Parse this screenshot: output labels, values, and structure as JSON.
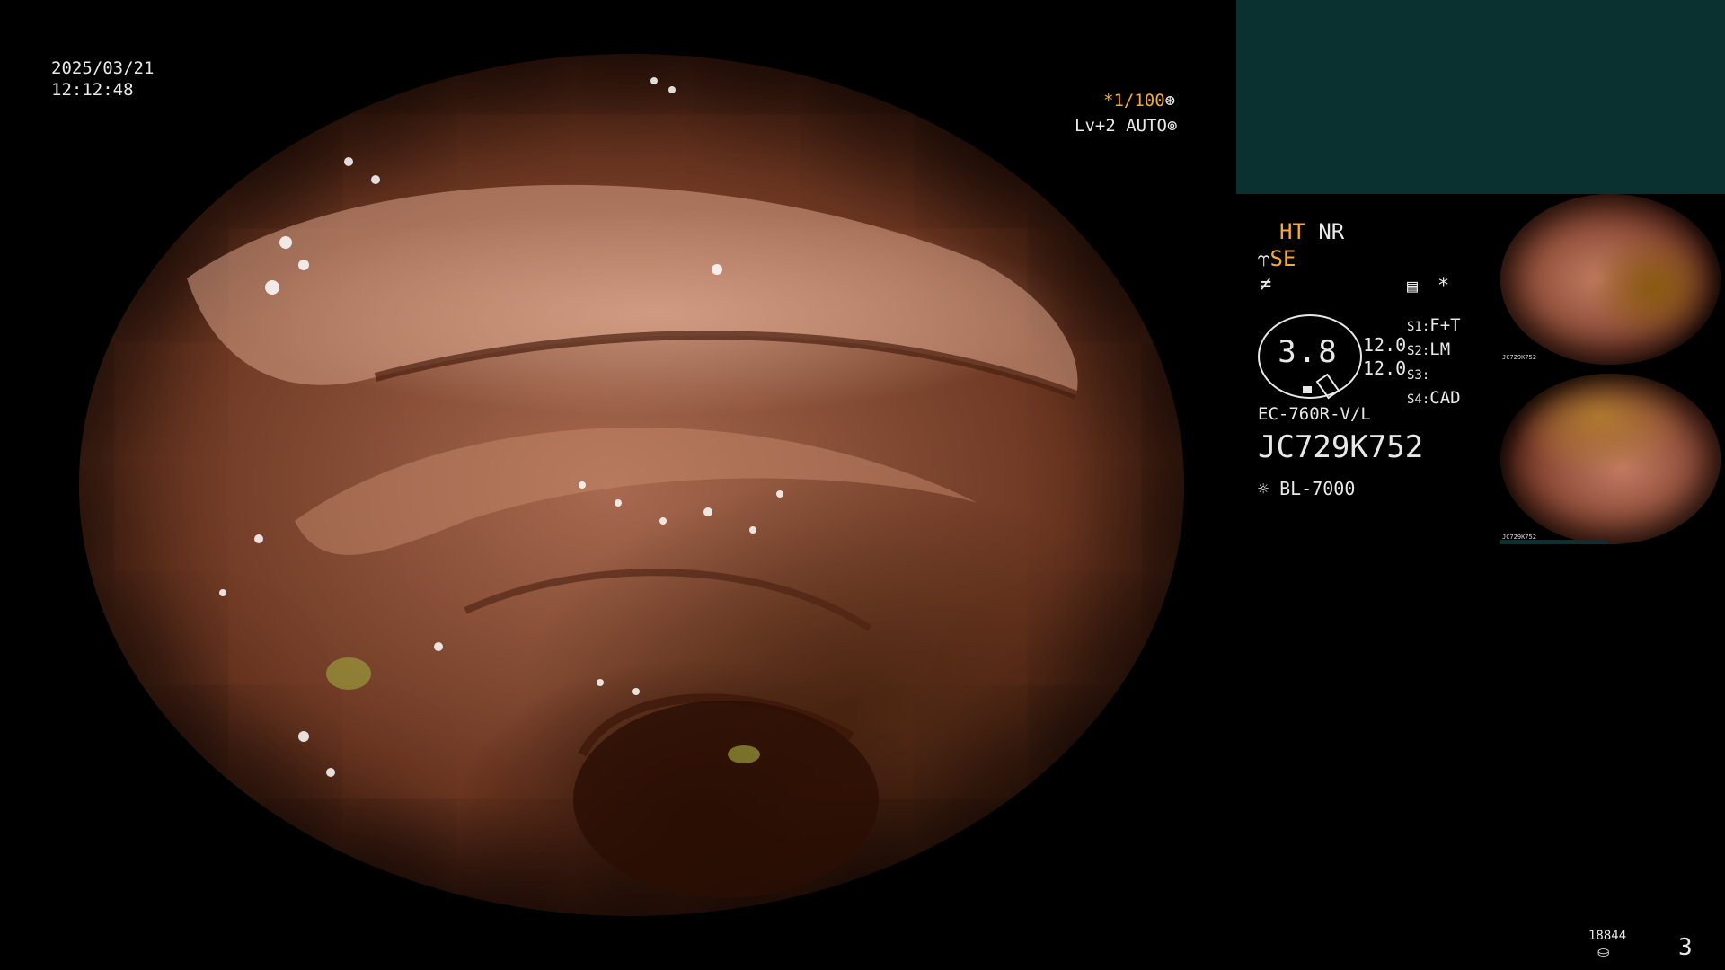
{
  "overlay": {
    "date": "2025/03/21",
    "time": "12:12:48",
    "shutter": "*1/100",
    "level": "Lv+2 AUTO"
  },
  "info": {
    "ht": "HT",
    "nr": "NR",
    "se": "SE",
    "gauge_value": "3.8",
    "val_top": "12.0",
    "val_bottom": "12.0",
    "switches": [
      {
        "key": "S1:",
        "value": "F+T"
      },
      {
        "key": "S2:",
        "value": "LM"
      },
      {
        "key": "S3:",
        "value": ""
      },
      {
        "key": "S4:",
        "value": "CAD"
      }
    ],
    "scope_model": "EC-760R-V/L",
    "serial": "JC729K752",
    "light_source": "BL-7000",
    "asterisk": "*"
  },
  "thumbnails": [
    {
      "serial": "JC729K752"
    },
    {
      "serial": "JC729K752"
    }
  ],
  "footer": {
    "storage_count": "18844",
    "page": "3"
  },
  "colors": {
    "accent_orange": "#f4a93a",
    "panel_teal": "#0b3030"
  }
}
